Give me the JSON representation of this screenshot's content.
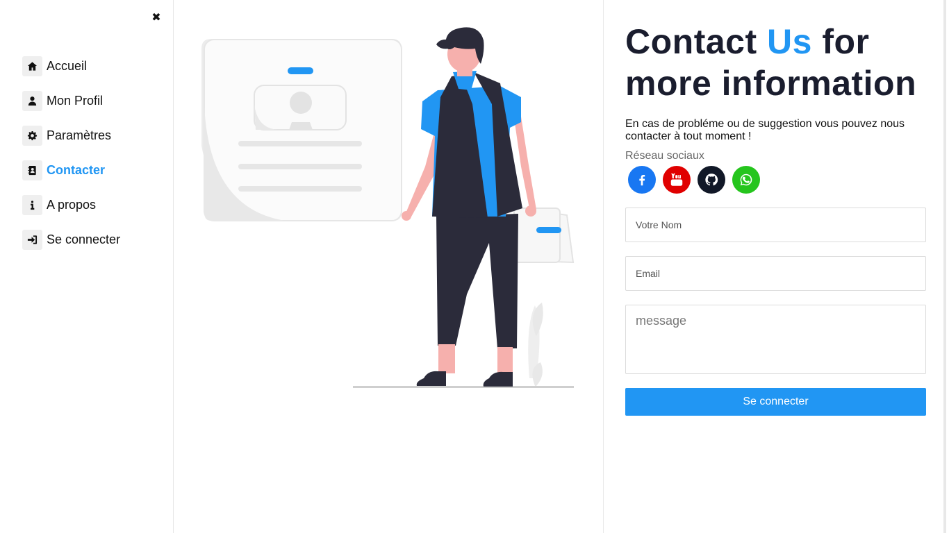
{
  "sidebar": {
    "close_icon": "times-icon",
    "items": [
      {
        "label": "Accueil",
        "icon": "home-icon",
        "active": false
      },
      {
        "label": "Mon Profil",
        "icon": "user-icon",
        "active": false
      },
      {
        "label": "Paramètres",
        "icon": "gear-icon",
        "active": false
      },
      {
        "label": "Contacter",
        "icon": "address-book-icon",
        "active": true
      },
      {
        "label": "A propos",
        "icon": "info-icon",
        "active": false
      },
      {
        "label": "Se connecter",
        "icon": "sign-in-icon",
        "active": false
      }
    ]
  },
  "contact": {
    "title_part1": "Contact ",
    "title_accent": "Us",
    "title_part2": " for more information",
    "description": "En cas de probléme ou de suggestion vous pouvez nous contacter à tout moment !",
    "social_label": "Réseau sociaux",
    "socials": [
      {
        "name": "facebook",
        "icon": "facebook-icon",
        "color": "#1877f2"
      },
      {
        "name": "youtube",
        "icon": "youtube-icon",
        "color": "#e00000"
      },
      {
        "name": "github",
        "icon": "github-icon",
        "color": "#111827"
      },
      {
        "name": "whatsapp",
        "icon": "whatsapp-icon",
        "color": "#25c51d"
      }
    ],
    "form": {
      "name_placeholder": "Votre Nom",
      "email_placeholder": "Email",
      "message_placeholder": "message",
      "submit_label": "Se connecter"
    }
  },
  "colors": {
    "accent": "#2196f3",
    "heading": "#1a1d2e"
  }
}
